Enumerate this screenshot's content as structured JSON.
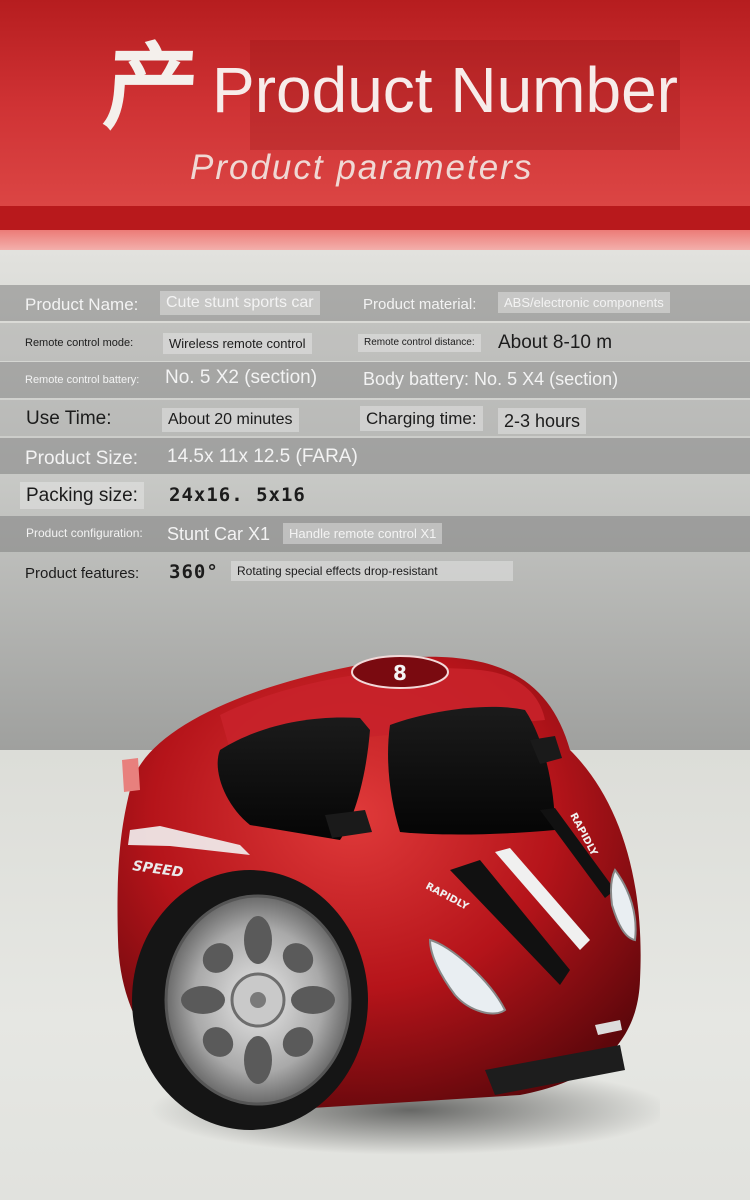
{
  "header": {
    "logo_char": "产",
    "title": "Product Number",
    "subtitle": "Product parameters"
  },
  "params": {
    "product_name_label": "Product Name:",
    "product_name_value": "Cute stunt sports car",
    "material_label": "Product material:",
    "material_value": "ABS/electronic components",
    "remote_mode_label": "Remote control mode:",
    "remote_mode_value": "Wireless remote control",
    "remote_distance_label": "Remote control distance:",
    "remote_distance_value": "About 8-10 m",
    "remote_battery_label": "Remote control battery:",
    "remote_battery_value": "No. 5 X2 (section)",
    "body_battery": "Body battery: No. 5 X4 (section)",
    "use_time_label": "Use Time:",
    "use_time_value": "About 20 minutes",
    "charging_label": "Charging time:",
    "charging_value": "2-3 hours",
    "size_label": "Product Size:",
    "size_value": "14.5x 11x 12.5 (FARA)",
    "packing_label": "Packing size:",
    "packing_value": "24x16. 5x16",
    "config_label": "Product configuration:",
    "config_value_1": "Stunt Car X1",
    "config_value_2": "Handle remote control X1",
    "features_label": "Product features:",
    "features_value_1": "360°",
    "features_value_2": "Rotating special effects drop-resistant"
  },
  "car": {
    "decals": [
      "SPEED",
      "RAPIDLY",
      "RAPIDLY"
    ],
    "body_color": "#c0161c"
  },
  "colors": {
    "header_red": "#cf3234",
    "stripe_red": "#b8191c"
  }
}
